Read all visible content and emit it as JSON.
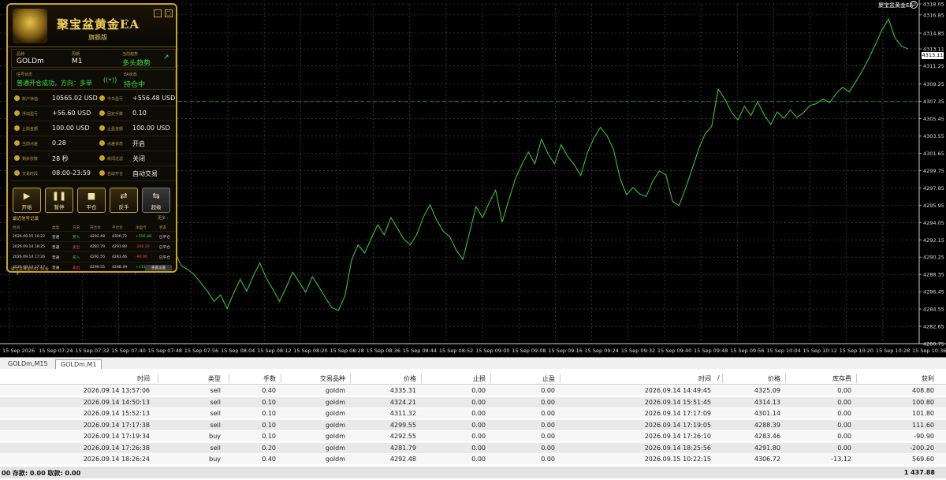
{
  "chart": {
    "ea_name_top": "聚宝盆黄金EA",
    "current_price_tag": "4313.11",
    "price_ticks": [
      "4318.05",
      "4316.85",
      "4314.85",
      "4313.11",
      "4311.25",
      "4309.25",
      "4307.35",
      "4305.45",
      "4303.55",
      "4301.65",
      "4299.75",
      "4297.85",
      "4295.95",
      "4294.05",
      "4292.15",
      "4290.25",
      "4288.35",
      "4286.45",
      "4284.55",
      "4282.65",
      "4280.75"
    ],
    "time_ticks": [
      "15 Sep 2026",
      "15 Sep 07:24",
      "15 Sep 07:32",
      "15 Sep 07:40",
      "15 Sep 07:48",
      "15 Sep 07:56",
      "15 Sep 08:04",
      "15 Sep 08:12",
      "15 Sep 08:20",
      "15 Sep 08:28",
      "15 Sep 08:36",
      "15 Sep 08:44",
      "15 Sep 08:52",
      "15 Sep 09:00",
      "15 Sep 09:08",
      "15 Sep 09:16",
      "15 Sep 09:24",
      "15 Sep 09:32",
      "15 Sep 09:40",
      "15 Sep 09:48",
      "15 Sep 09:56",
      "15 Sep 10:04",
      "15 Sep 10:12",
      "15 Sep 10:20",
      "15 Sep 10:28",
      "15 Sep 10:36"
    ],
    "line_color": "#3cd43c",
    "price_series": [
      4291.2,
      4288.4,
      4290.1,
      4289.0,
      4291.6,
      4290.3,
      4292.2,
      4291.0,
      4289.9,
      4291.3,
      4290.5,
      4292.0,
      4290.8,
      4289.5,
      4291.0,
      4289.8,
      4290.3,
      4288.9,
      4289.6,
      4288.5,
      4289.9,
      4288.8,
      4289.4,
      4288.6,
      4289.5,
      4290.8,
      4289.3,
      4288.9,
      4288.3,
      4287.4,
      4286.5,
      4285.4,
      4286.1,
      4284.6,
      4286.3,
      4287.8,
      4286.5,
      4288.2,
      4289.6,
      4287.9,
      4286.7,
      4285.4,
      4286.9,
      4288.6,
      4287.5,
      4286.4,
      4288.1,
      4287.0,
      4285.8,
      4284.7,
      4284.4,
      4286.0,
      4289.9,
      4291.6,
      4290.7,
      4292.3,
      4293.8,
      4292.7,
      4294.6,
      4293.4,
      4292.2,
      4291.6,
      4292.8,
      4294.7,
      4296.0,
      4294.3,
      4293.1,
      4292.5,
      4291.0,
      4290.0,
      4292.9,
      4295.8,
      4294.6,
      4296.2,
      4297.6,
      4294.1,
      4296.5,
      4298.8,
      4300.4,
      4301.8,
      4300.5,
      4303.2,
      4301.6,
      4300.5,
      4302.6,
      4301.3,
      4300.4,
      4299.2,
      4301.7,
      4303.3,
      4304.5,
      4303.6,
      4302.1,
      4298.9,
      4297.1,
      4297.9,
      4297.2,
      4296.9,
      4298.6,
      4299.7,
      4299.3,
      4296.4,
      4295.9,
      4297.8,
      4299.9,
      4302.1,
      4303.8,
      4304.6,
      4308.7,
      4307.6,
      4306.2,
      4305.3,
      4306.8,
      4305.8,
      4307.3,
      4305.9,
      4304.8,
      4306.2,
      4305.5,
      4306.4,
      4305.6,
      4306.1,
      4306.9,
      4307.1,
      4307.6,
      4307.2,
      4308.2,
      4308.9,
      4308.4,
      4309.5,
      4310.7,
      4312.1,
      4313.6,
      4315.2,
      4316.4,
      4314.3,
      4313.4,
      4313.1
    ],
    "dashed_level": 4307.35
  },
  "ea_panel": {
    "title": "聚宝盆黄金EA",
    "subtitle": "旗舰版",
    "symbol_label": "品种",
    "symbol_value": "GOLDm",
    "period_label": "周期",
    "period_value": "M1",
    "trend_label": "当前趋势",
    "trend_value": "多头趋势",
    "signal_label": "信号状态",
    "signal_value": "普通开仓成功，方向：多单",
    "ea_state_label": "EA状态",
    "ea_state_value": "持仓中",
    "stats": [
      {
        "label": "账户净值",
        "value": "10565.02 USD",
        "label2": "今日盈亏",
        "value2": "+556.48 USD"
      },
      {
        "label": "浮动盈亏",
        "value": "+56.60 USD",
        "label2": "固定手数",
        "value2": "0.10"
      },
      {
        "label": "止损金额",
        "value": "100.00 USD",
        "label2": "止盈金额",
        "value2": "100.00 USD"
      },
      {
        "label": "当前点差",
        "value": "0.28",
        "label2": "点差状态",
        "value2": "开启"
      },
      {
        "label": "剩余秒数",
        "value": "28 秒",
        "label2": "新闻过滤",
        "value2": "关闭"
      },
      {
        "label": "交易时段",
        "value": "08:00-23:59",
        "label2": "自动开仓",
        "value2": "自动交易"
      }
    ],
    "buttons": [
      {
        "icon": "▶",
        "label": "开始"
      },
      {
        "icon": "❚❚",
        "label": "暂停"
      },
      {
        "icon": "■",
        "label": "平仓"
      },
      {
        "icon": "⇄",
        "label": "反手"
      },
      {
        "icon": "⇆",
        "label": "超级"
      }
    ],
    "log_title": "最近信号记录",
    "log_more": "更多 ›",
    "log_headers": [
      "时间",
      "类型",
      "方向",
      "开仓价",
      "平仓价",
      "净盈亏",
      "状态"
    ],
    "log_rows": [
      [
        "2026.09.15 10:22",
        "普通",
        "买入",
        "4292.48",
        "4306.72",
        "+556.48",
        "已平仓"
      ],
      [
        "2026.09.14 18:25",
        "普通",
        "卖出",
        "4281.79",
        "4291.80",
        "-200.20",
        "已平仓"
      ],
      [
        "2026.09.14 17:26",
        "普通",
        "买入",
        "4292.55",
        "4283.46",
        "-90.90",
        "已平仓"
      ],
      [
        "2026.09.14 17:17",
        "普通",
        "卖出",
        "4299.55",
        "4288.39",
        "+111.60",
        "已平仓"
      ],
      [
        "2026.09.14 17:17",
        "普通",
        "卖出",
        "4311.32",
        "4301.14",
        "+101.80",
        "已平仓"
      ]
    ],
    "footer_text": "聚宝盆黄金EA1.34版",
    "footer_button": "重置设置"
  },
  "tabs": [
    "GOLDm,M15",
    "GOLDm,M1"
  ],
  "trade_table": {
    "headers": [
      "时间",
      "类型",
      "手数",
      "交易品种",
      "价格",
      "止损",
      "止盈",
      "时间",
      "/",
      "价格",
      "库存费",
      "获利"
    ],
    "rows": [
      [
        "2026.09.14 13:57:06",
        "sell",
        "0.40",
        "goldm",
        "4335.31",
        "0.00",
        "0.00",
        "2026.09.14 14:49:45",
        "4325.09",
        "0.00",
        "408.80"
      ],
      [
        "2026.09.14 14:50:13",
        "sell",
        "0.10",
        "goldm",
        "4324.21",
        "0.00",
        "0.00",
        "2026.09.14 15:51:45",
        "4314.13",
        "0.00",
        "100.80"
      ],
      [
        "2026.09.14 15:52:13",
        "sell",
        "0.10",
        "goldm",
        "4311.32",
        "0.00",
        "0.00",
        "2026.09.14 17:17:09",
        "4301.14",
        "0.00",
        "101.80"
      ],
      [
        "2026.09.14 17:17:38",
        "sell",
        "0.10",
        "goldm",
        "4299.55",
        "0.00",
        "0.00",
        "2026.09.14 17:19:05",
        "4288.39",
        "0.00",
        "111.60"
      ],
      [
        "2026.09.14 17:19:34",
        "buy",
        "0.10",
        "goldm",
        "4292.55",
        "0.00",
        "0.00",
        "2026.09.14 17:26:10",
        "4283.46",
        "0.00",
        "-90.90"
      ],
      [
        "2026.09.14 17:26:38",
        "sell",
        "0.20",
        "goldm",
        "4281.79",
        "0.00",
        "0.00",
        "2026.09.14 18:25:56",
        "4291.80",
        "0.00",
        "-200.20"
      ],
      [
        "2026.09.14 18:26:24",
        "buy",
        "0.40",
        "goldm",
        "4292.48",
        "0.00",
        "0.00",
        "2026.09.15 10:22:15",
        "4306.72",
        "-13.12",
        "569.60"
      ]
    ],
    "total_left": "00  存款: 0.00  取款: 0.00",
    "total_right": "1 437.88"
  }
}
